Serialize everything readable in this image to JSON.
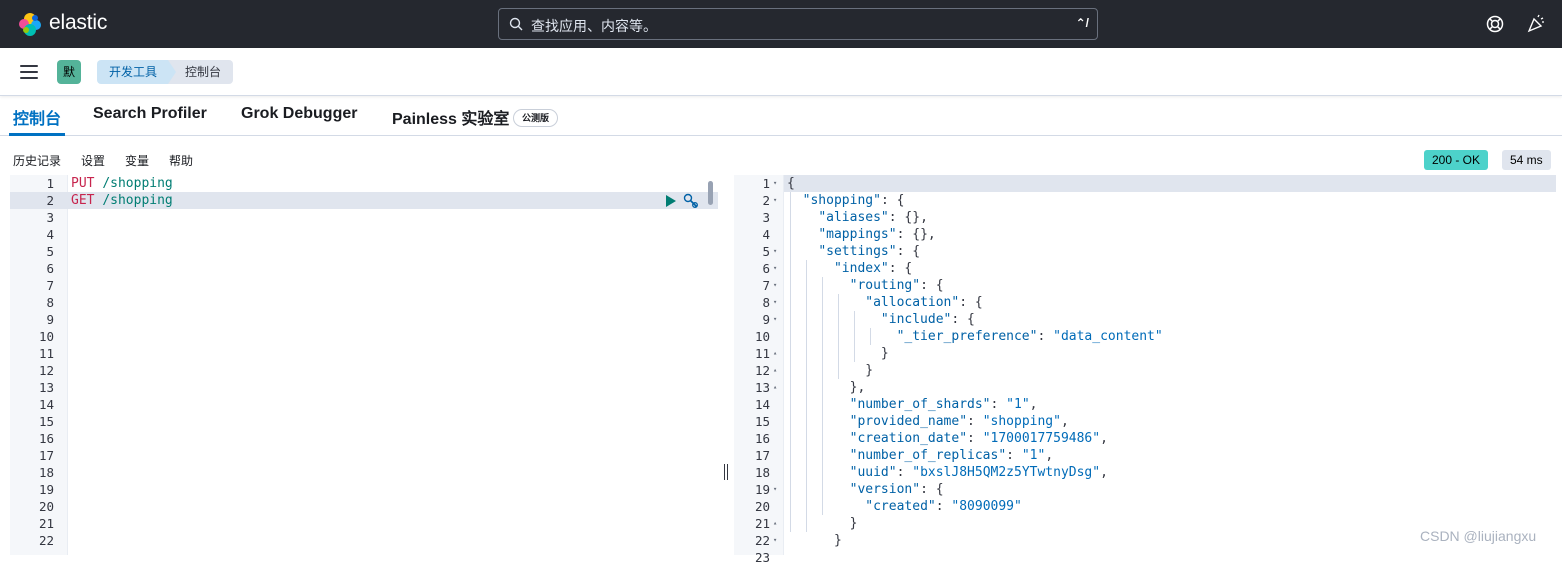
{
  "header": {
    "brand": "elastic",
    "search_placeholder": "查找应用、内容等。",
    "search_shortcut": "⌃/",
    "space_avatar": "默"
  },
  "breadcrumbs": [
    "开发工具",
    "控制台"
  ],
  "tabs": [
    "控制台",
    "Search Profiler",
    "Grok Debugger",
    "Painless 实验室"
  ],
  "beta_badge": "公测版",
  "toolbar": {
    "history": "历史记录",
    "settings": "设置",
    "variables": "变量",
    "help": "帮助"
  },
  "response_status": "200 - OK",
  "response_time": "54 ms",
  "request_lines": [
    {
      "method": "PUT",
      "path": "/shopping"
    },
    {
      "method": "GET",
      "path": "/shopping"
    }
  ],
  "request_line_count": 22,
  "response_lines": [
    "{",
    "  \"shopping\": {",
    "    \"aliases\": {},",
    "    \"mappings\": {},",
    "    \"settings\": {",
    "      \"index\": {",
    "        \"routing\": {",
    "          \"allocation\": {",
    "            \"include\": {",
    "              \"_tier_preference\": \"data_content\"",
    "            }",
    "          }",
    "        },",
    "        \"number_of_shards\": \"1\",",
    "        \"provided_name\": \"shopping\",",
    "        \"creation_date\": \"1700017759486\",",
    "        \"number_of_replicas\": \"1\",",
    "        \"uuid\": \"bxslJ8H5QM2z5YTwtnyDsg\",",
    "        \"version\": {",
    "          \"created\": \"8090099\"",
    "        }",
    "      }"
  ],
  "fold_markers": {
    "1": "▾",
    "2": "▾",
    "5": "▾",
    "6": "▾",
    "7": "▾",
    "8": "▾",
    "9": "▾",
    "11": "▴",
    "12": "▴",
    "13": "▴",
    "19": "▾",
    "21": "▴",
    "22": "▾"
  },
  "watermark": "CSDN @liujiangxu"
}
